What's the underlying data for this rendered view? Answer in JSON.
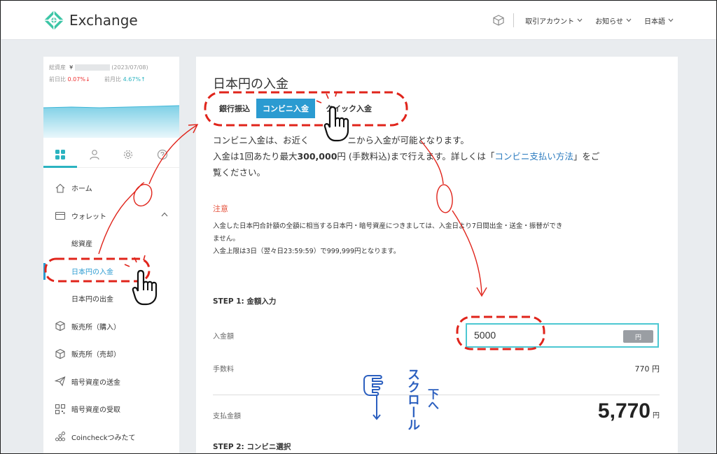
{
  "header": {
    "app_name": "Exchange",
    "nav": [
      {
        "label": "取引アカウント"
      },
      {
        "label": "お知らせ"
      },
      {
        "label": "日本語"
      }
    ]
  },
  "sidebar": {
    "asset_summary": {
      "total_label": "総資産",
      "currency": "¥",
      "date": "(2023/07/08)",
      "day_label": "前日比",
      "day_change": "0.07%↓",
      "month_label": "前月比",
      "month_change": "4.67%↑"
    },
    "tabs": [
      {
        "icon": "dashboard-grid-icon"
      },
      {
        "icon": "user-icon"
      },
      {
        "icon": "gear-icon"
      },
      {
        "icon": "help-icon"
      }
    ],
    "items": [
      {
        "label": "ホーム",
        "icon": "home-icon"
      },
      {
        "label": "ウォレット",
        "icon": "wallet-icon"
      },
      {
        "label": "総資産"
      },
      {
        "label": "日本円の入金"
      },
      {
        "label": "日本円の出金"
      },
      {
        "label": "販売所（購入）",
        "icon": "cube-icon"
      },
      {
        "label": "販売所（売却）",
        "icon": "cube-icon"
      },
      {
        "label": "暗号資産の送金",
        "icon": "send-icon"
      },
      {
        "label": "暗号資産の受取",
        "icon": "qr-icon"
      },
      {
        "label": "Coincheckつみたて",
        "icon": "coins-icon"
      }
    ]
  },
  "main": {
    "title": "日本円の入金",
    "tabs": [
      {
        "label": "銀行振込"
      },
      {
        "label": "コンビニ入金"
      },
      {
        "label": "クイック入金"
      }
    ],
    "desc": {
      "line1_a": "コンビニ入金は、お近く",
      "line1_b": "ニから入金が可能となります。",
      "line2_a": "入金は1回あたり最大",
      "line2_amount": "300,000",
      "line2_b": "円 (手数料込)まで行えます。詳しくは「",
      "line2_link": "コンビニ支払い方法",
      "line2_c": "」をご",
      "line3": "覧ください。"
    },
    "notice": {
      "title": "注意",
      "line1": "入金した日本円合計額の全額に相当する日本円・暗号資産につきましては、入金日より7日間出金・送金・振替ができ",
      "line2": "ません。",
      "line3": "入金上限は3日（翌々日23:59:59）で999,999円となります。"
    },
    "step1": {
      "title": "STEP 1: 金額入力",
      "amount_label": "入金額",
      "amount_value": "5000",
      "amount_unit": "円",
      "fee_label": "手数料",
      "fee_value": "770 円",
      "total_label": "支払金額",
      "total_value": "5,770",
      "total_unit": "円"
    },
    "step2": {
      "title": "STEP 2: コンビニ選択"
    }
  },
  "annotation": {
    "scroll_text": "スクロール",
    "down_text": "下へ",
    "color": "#e0241b",
    "scroll_color": "#2b5fbf"
  }
}
